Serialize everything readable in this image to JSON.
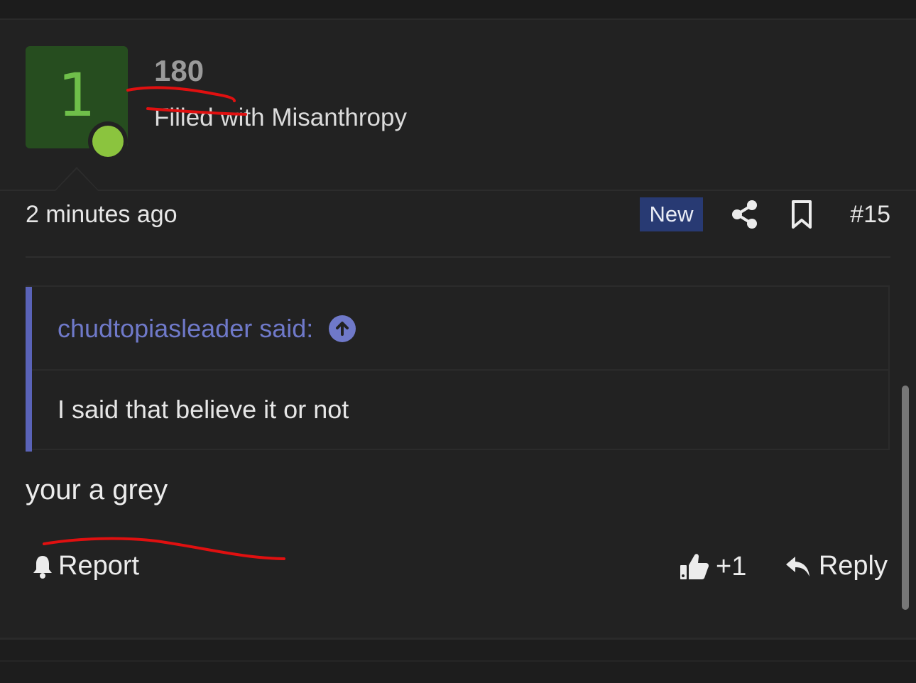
{
  "user": {
    "avatar_letter": "1",
    "avatar_color": "#264d1f",
    "online_color": "#8bc43e",
    "username": "180",
    "title": "Filled with Misanthropy"
  },
  "post": {
    "timestamp": "2 minutes ago",
    "new_badge": "New",
    "share_icon": "share-icon",
    "bookmark_icon": "bookmark-icon",
    "post_number": "#15",
    "quote": {
      "author": "chudtopiasleader said:",
      "expand_icon": "arrow-up-circle-icon",
      "text": "I said that believe it or not"
    },
    "message": "your a grey",
    "actions": {
      "report_label": "Report",
      "like_label": "+1",
      "reply_label": "Reply"
    }
  },
  "colors": {
    "accent": "#6f79c9",
    "badge_bg": "#283a73",
    "annotation_red": "#e01010"
  }
}
